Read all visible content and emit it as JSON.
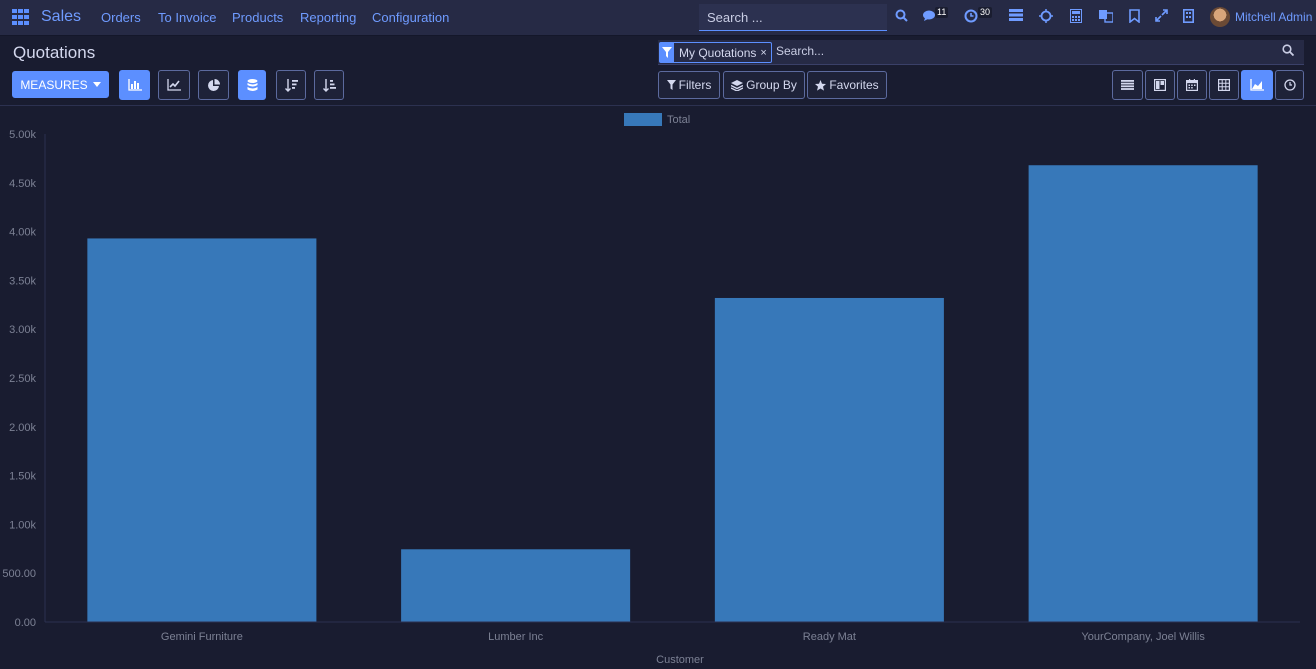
{
  "topbar": {
    "app_name": "Sales",
    "menu": [
      "Orders",
      "To Invoice",
      "Products",
      "Reporting",
      "Configuration"
    ],
    "search_placeholder": "Search ...",
    "messages_count": "11",
    "activities_count": "30",
    "user_name": "Mitchell Admin",
    "icons": [
      "apps-grid-icon",
      "search-icon",
      "chat-icon",
      "clock-icon",
      "list-icon",
      "bug-icon",
      "calculator-icon",
      "translate-icon",
      "bookmark-icon",
      "expand-icon",
      "company-icon"
    ]
  },
  "control_panel": {
    "title": "Quotations",
    "facet_label": "My Quotations",
    "facet_close": "×",
    "search_placeholder": "Search...",
    "measures_label": "MEASURES",
    "filters_label": "Filters",
    "groupby_label": "Group By",
    "favorites_label": "Favorites",
    "accent_color": "#5c8fff"
  },
  "chart_data": {
    "type": "bar",
    "legend": [
      "Total"
    ],
    "legend_position": "top-center",
    "xlabel": "Customer",
    "categories": [
      "Gemini Furniture",
      "Lumber Inc",
      "Ready Mat",
      "YourCompany, Joel Willis"
    ],
    "series": [
      {
        "name": "Total",
        "values": [
          3930,
          745,
          3320,
          4680
        ],
        "color": "#3778b9"
      }
    ],
    "ylim": [
      0,
      5000
    ],
    "yticks": [
      "0.00",
      "500.00",
      "1.00k",
      "1.50k",
      "2.00k",
      "2.50k",
      "3.00k",
      "3.50k",
      "4.00k",
      "4.50k",
      "5.00k"
    ],
    "grid": false
  }
}
